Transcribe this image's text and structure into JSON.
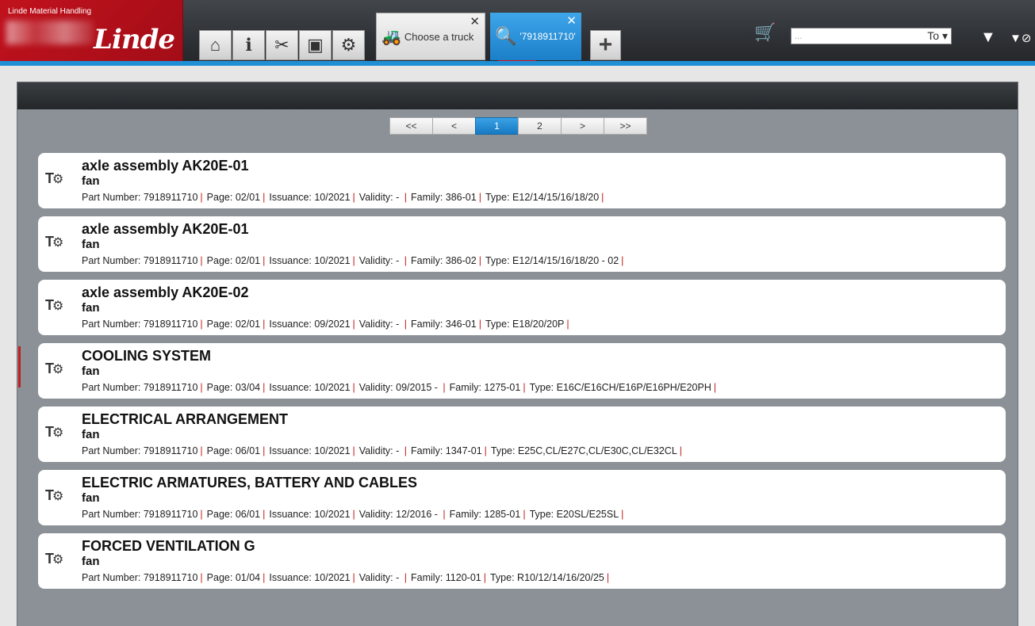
{
  "logo": {
    "small_text": "Linde Material Handling",
    "brand": "Linde"
  },
  "nav": [
    {
      "name": "home-icon",
      "glyph": "⌂"
    },
    {
      "name": "info-icon",
      "glyph": "ℹ"
    },
    {
      "name": "tools-icon",
      "glyph": "✂"
    },
    {
      "name": "toolbox-icon",
      "glyph": "▣"
    },
    {
      "name": "gear-icon",
      "glyph": "⚙"
    }
  ],
  "tabs": {
    "truck_label": "Choose a truck",
    "search_label": "'7918911710'",
    "close_glyph": "✕",
    "add_glyph": "+"
  },
  "search": {
    "placeholder": "...",
    "type_label": "To ▾"
  },
  "icons": {
    "cart": "🛒",
    "filter": "▼",
    "filter_clear": "▼⊘"
  },
  "pager": {
    "buttons": [
      "<<",
      "<",
      "1",
      "2",
      ">",
      ">>"
    ],
    "active": "1"
  },
  "labels": {
    "part_number": "Part Number:",
    "page": "Page:",
    "issuance": "Issuance:",
    "validity": "Validity:",
    "family": "Family:",
    "type": "Type:"
  },
  "results": [
    {
      "title": "axle assembly AK20E-01",
      "sub": "fan",
      "part_number": "7918911710",
      "page": "02/01",
      "issuance": "10/2021",
      "validity": " - ",
      "family": "386-01",
      "type": "E12/14/15/16/18/20"
    },
    {
      "title": "axle assembly AK20E-01",
      "sub": "fan",
      "part_number": "7918911710",
      "page": "02/01",
      "issuance": "10/2021",
      "validity": " - ",
      "family": "386-02",
      "type": "E12/14/15/16/18/20 - 02"
    },
    {
      "title": "axle assembly AK20E-02",
      "sub": "fan",
      "part_number": "7918911710",
      "page": "02/01",
      "issuance": "09/2021",
      "validity": " - ",
      "family": "346-01",
      "type": "E18/20/20P"
    },
    {
      "title": "COOLING SYSTEM",
      "sub": "fan",
      "part_number": "7918911710",
      "page": "03/04",
      "issuance": "10/2021",
      "validity": "09/2015 - ",
      "family": "1275-01",
      "type": "E16C/E16CH/E16P/E16PH/E20PH"
    },
    {
      "title": "ELECTRICAL ARRANGEMENT",
      "sub": "fan",
      "part_number": "7918911710",
      "page": "06/01",
      "issuance": "10/2021",
      "validity": " - ",
      "family": "1347-01",
      "type": "E25C,CL/E27C,CL/E30C,CL/E32CL"
    },
    {
      "title": "ELECTRIC ARMATURES, BATTERY AND CABLES",
      "sub": "fan",
      "part_number": "7918911710",
      "page": "06/01",
      "issuance": "10/2021",
      "validity": "12/2016 - ",
      "family": "1285-01",
      "type": "E20SL/E25SL"
    },
    {
      "title": "FORCED VENTILATION G",
      "sub": "fan",
      "part_number": "7918911710",
      "page": "01/04",
      "issuance": "10/2021",
      "validity": " - ",
      "family": "1120-01",
      "type": "R10/12/14/16/20/25"
    }
  ]
}
